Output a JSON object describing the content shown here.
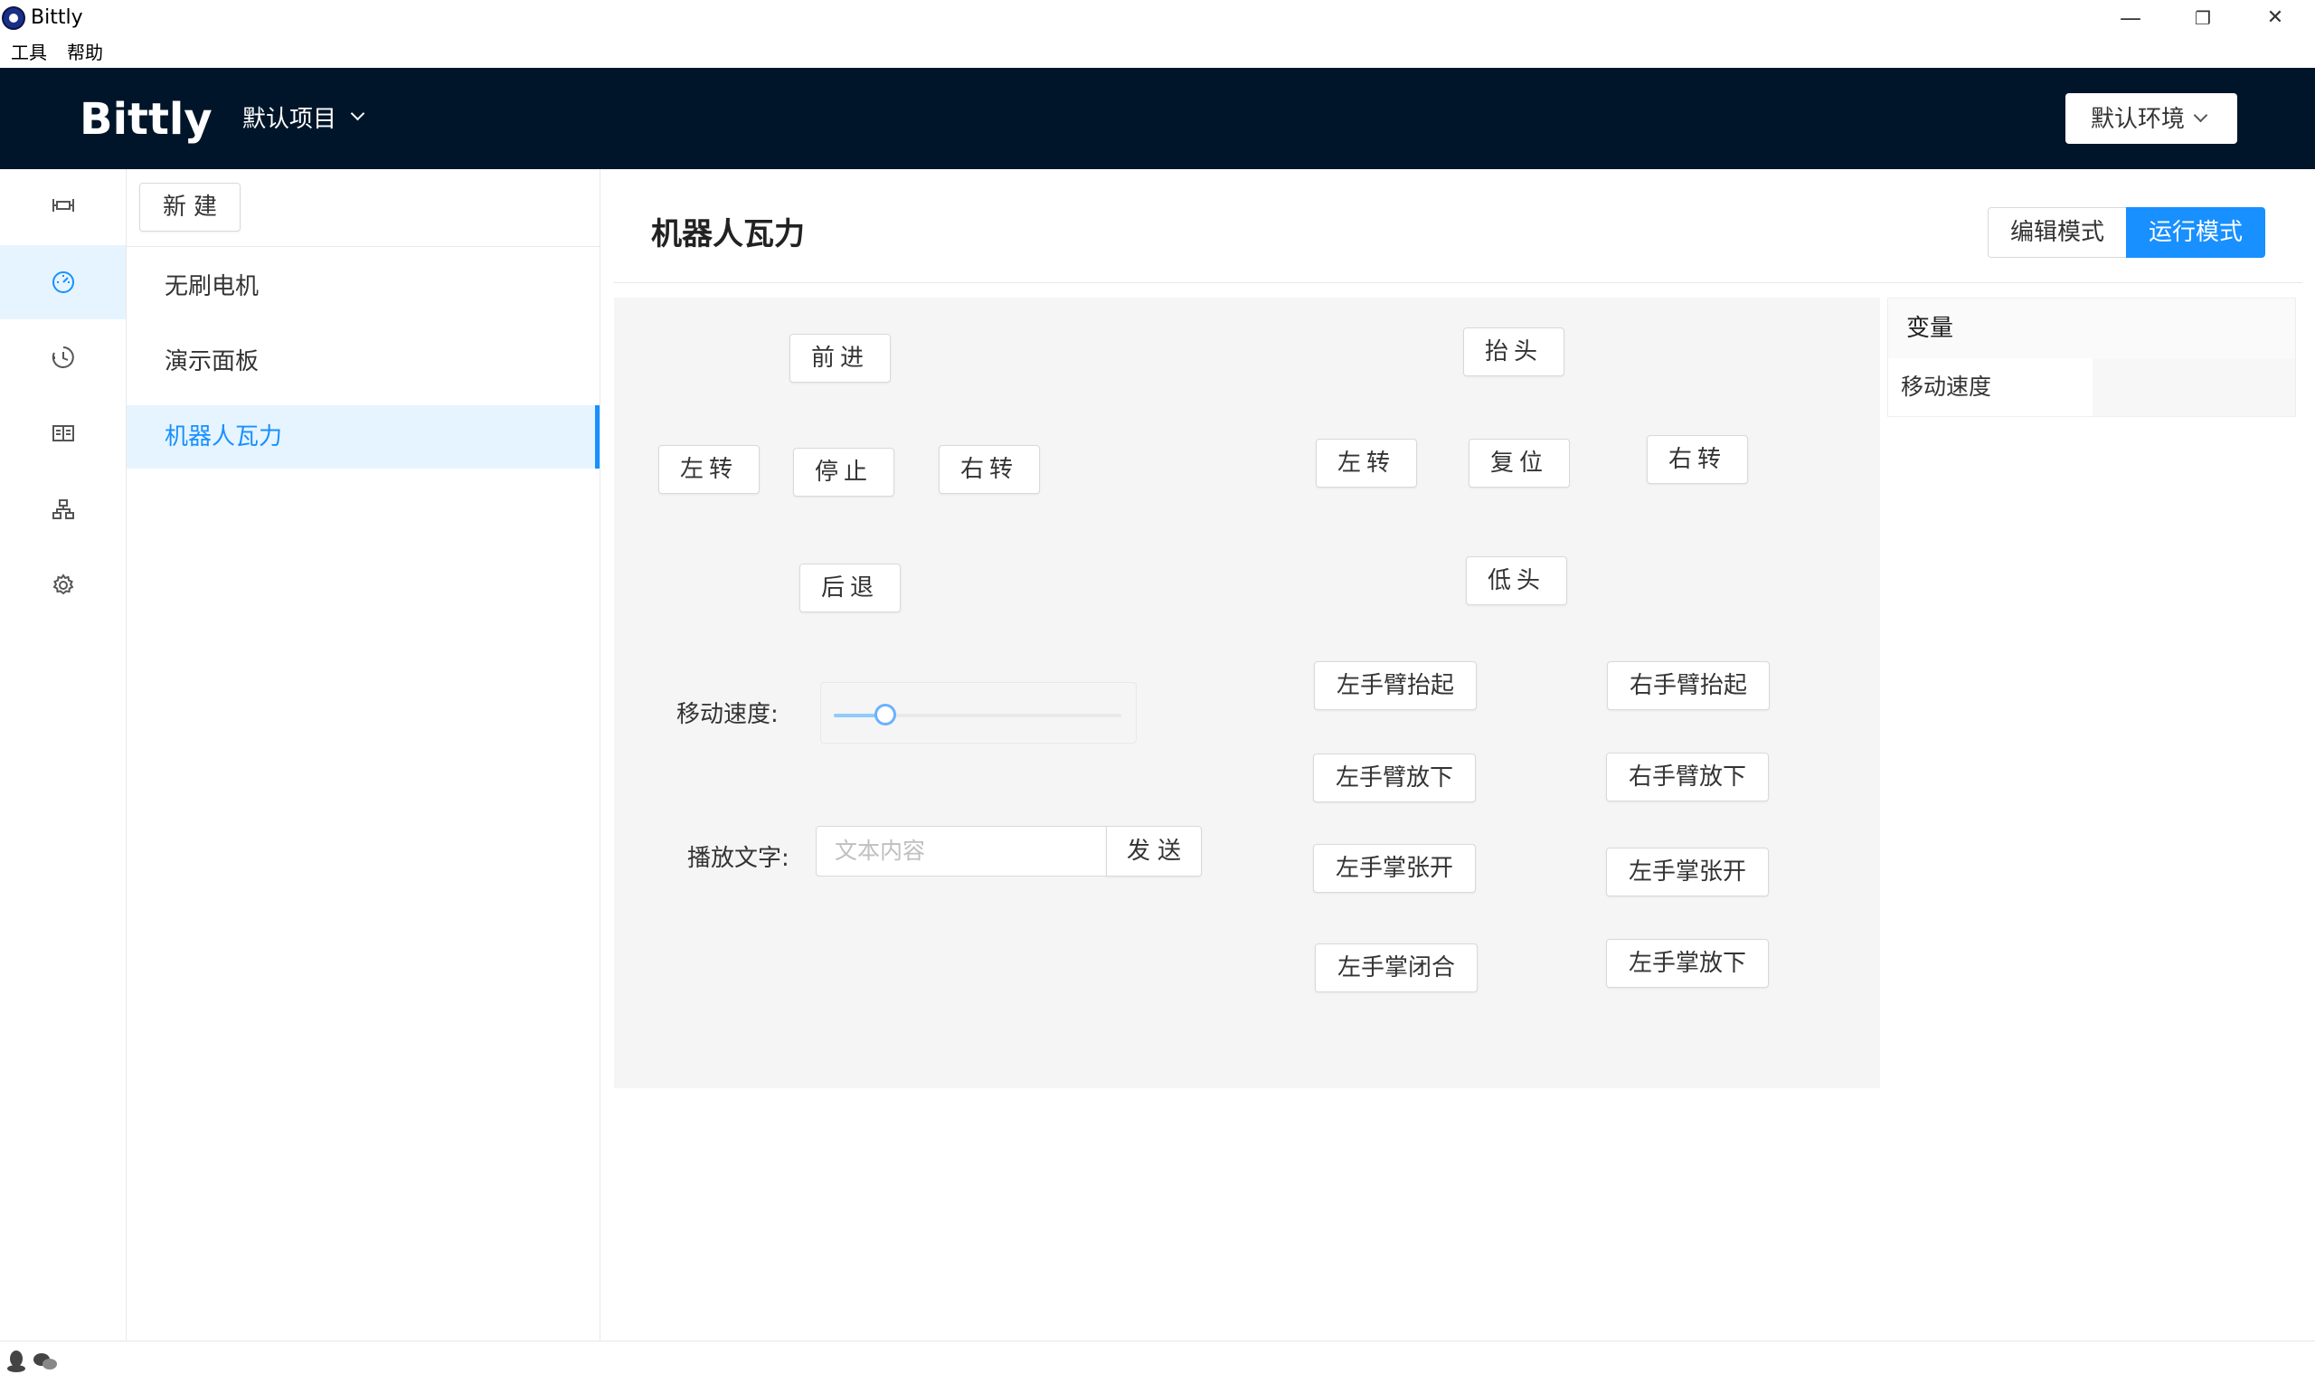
{
  "window": {
    "title": "Bittly",
    "minimize_glyph": "—",
    "restore_glyph": "❐",
    "close_glyph": "✕"
  },
  "menubar": {
    "items": [
      "工具",
      "帮助"
    ]
  },
  "header": {
    "brand": "Bittly",
    "project": "默认项目",
    "environment": "默认环境"
  },
  "rail": {
    "items": [
      {
        "icon": "ruler-icon",
        "active": false
      },
      {
        "icon": "dashboard-icon",
        "active": true
      },
      {
        "icon": "history-icon",
        "active": false
      },
      {
        "icon": "book-icon",
        "active": false
      },
      {
        "icon": "cluster-icon",
        "active": false
      },
      {
        "icon": "gear-icon",
        "active": false
      }
    ]
  },
  "sidebar": {
    "new_label": "新建",
    "items": [
      {
        "label": "无刷电机",
        "active": false
      },
      {
        "label": "演示面板",
        "active": false
      },
      {
        "label": "机器人瓦力",
        "active": true
      }
    ]
  },
  "main": {
    "title": "机器人瓦力",
    "modes": {
      "edit": "编辑模式",
      "run": "运行模式",
      "active": "run"
    }
  },
  "panel": {
    "buttons": {
      "forward": "前进",
      "left": "左转",
      "stop": "停止",
      "right": "右转",
      "backward": "后退",
      "head_up": "抬头",
      "head_left": "左转",
      "head_reset": "复位",
      "head_right": "右转",
      "head_down": "低头",
      "left_arm_up": "左手臂抬起",
      "right_arm_up": "右手臂抬起",
      "left_arm_down": "左手臂放下",
      "right_arm_down": "右手臂放下",
      "left_palm_open": "左手掌张开",
      "left_palm_open_2": "左手掌张开",
      "left_palm_close": "左手掌闭合",
      "left_palm_down": "左手掌放下"
    },
    "speed_label": "移动速度:",
    "speed_fraction": 0.18,
    "text_label": "播放文字:",
    "text_placeholder": "文本内容",
    "send_label": "发送"
  },
  "variables": {
    "header": "变量",
    "rows": [
      {
        "name": "移动速度",
        "value": ""
      }
    ]
  },
  "colors": {
    "header_bg": "#001529",
    "accent": "#1890ff",
    "active_bg": "#e6f4ff"
  }
}
